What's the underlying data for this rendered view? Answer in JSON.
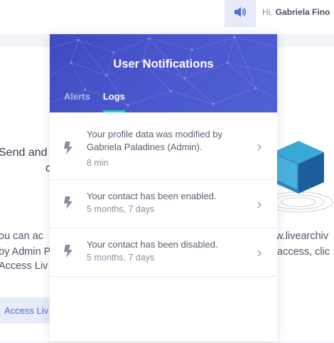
{
  "header": {
    "greeting_hi": "Hi,",
    "user_name": "Gabriela Fino"
  },
  "background": {
    "title_left": "Send and",
    "title_left_line2": "c",
    "para_left_line1": "ou can ac",
    "para_left_line2": "by Admin P",
    "para_left_line3": "Access Liv",
    "para_right_line1": "w.livearchiv",
    "para_right_line2": "access, clic",
    "access_button": "Access Liv"
  },
  "notifications": {
    "title": "User Notifications",
    "tabs": [
      {
        "label": "Alerts",
        "active": false
      },
      {
        "label": "Logs",
        "active": true
      }
    ],
    "items": [
      {
        "message_line1": "Your profile data was modified by",
        "message_line2": "Gabriela Paladines (Admin).",
        "time": "8 min"
      },
      {
        "message": "Your contact has been enabled.",
        "time": "5 months, 7 days"
      },
      {
        "message": "Your contact has been disabled.",
        "time": "5 months, 7 days"
      }
    ]
  },
  "colors": {
    "header_gradient_start": "#3e4bc0",
    "header_gradient_end": "#5060d4",
    "active_tab_underline": "#2ed3a4",
    "speaker_icon": "#5867dd",
    "bolt_icon": "#8a8d9c"
  },
  "icons": [
    "speaker-icon",
    "bolt-icon",
    "chevron-right-icon",
    "cube-illustration"
  ]
}
